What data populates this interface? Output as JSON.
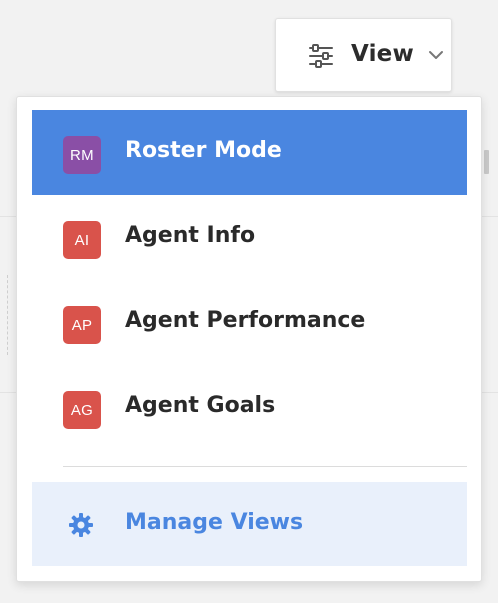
{
  "view_button": {
    "label": "View",
    "icon": "sliders-icon",
    "dropdown_icon": "chevron-down-icon"
  },
  "menu": {
    "items": [
      {
        "badge": "RM",
        "label": "Roster Mode",
        "badge_color": "#8a4fa6",
        "selected": true
      },
      {
        "badge": "AI",
        "label": "Agent Info",
        "badge_color": "#d9534b",
        "selected": false
      },
      {
        "badge": "AP",
        "label": "Agent Performance",
        "badge_color": "#d9534b",
        "selected": false
      },
      {
        "badge": "AG",
        "label": "Agent Goals",
        "badge_color": "#d9534b",
        "selected": false
      }
    ],
    "manage": {
      "label": "Manage Views",
      "icon": "gear-icon"
    }
  },
  "colors": {
    "accent": "#4a86e0",
    "manage_bg": "#e9f0fb",
    "text": "#2a2a2a"
  }
}
